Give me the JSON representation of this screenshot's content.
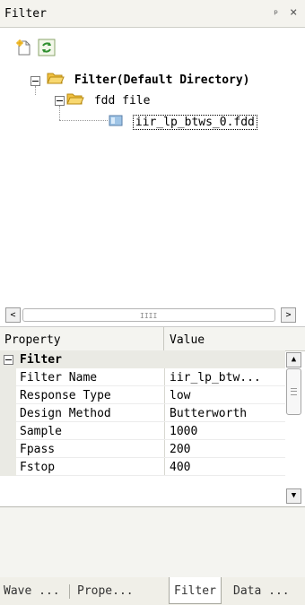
{
  "panel": {
    "title": "Filter",
    "pin": "ᵖ",
    "close": "×"
  },
  "toolbar": {
    "new_icon": "new-file-icon",
    "refresh_icon": "refresh-icon"
  },
  "tree": {
    "root": {
      "label": "Filter(Default Directory)",
      "icon": "folder-open-icon"
    },
    "child": {
      "label": "fdd file",
      "icon": "folder-open-icon"
    },
    "leaf": {
      "label": "iir_lp_btws_0.fdd",
      "icon": "file-icon"
    }
  },
  "hscroll": {
    "left": "<",
    "right": ">",
    "grip": "IIII"
  },
  "properties": {
    "col_property": "Property",
    "col_value": "Value",
    "category": "Filter",
    "rows": [
      {
        "name": "Filter Name",
        "value": "iir_lp_btw..."
      },
      {
        "name": "Response Type",
        "value": "low"
      },
      {
        "name": "Design Method",
        "value": "Butterworth"
      },
      {
        "name": "Sample",
        "value": "1000"
      },
      {
        "name": "Fpass",
        "value": "200"
      },
      {
        "name": "Fstop",
        "value": "400"
      }
    ],
    "scroll_up": "▲",
    "scroll_down": "▼"
  },
  "tabs": [
    {
      "label": "Wave ..."
    },
    {
      "label": "Prope..."
    },
    {
      "label": "Filter"
    },
    {
      "label": "Data ..."
    }
  ],
  "colors": {
    "folder": "#f3c84a",
    "refresh": "#2f8f2f",
    "selection_border": "#000000"
  }
}
